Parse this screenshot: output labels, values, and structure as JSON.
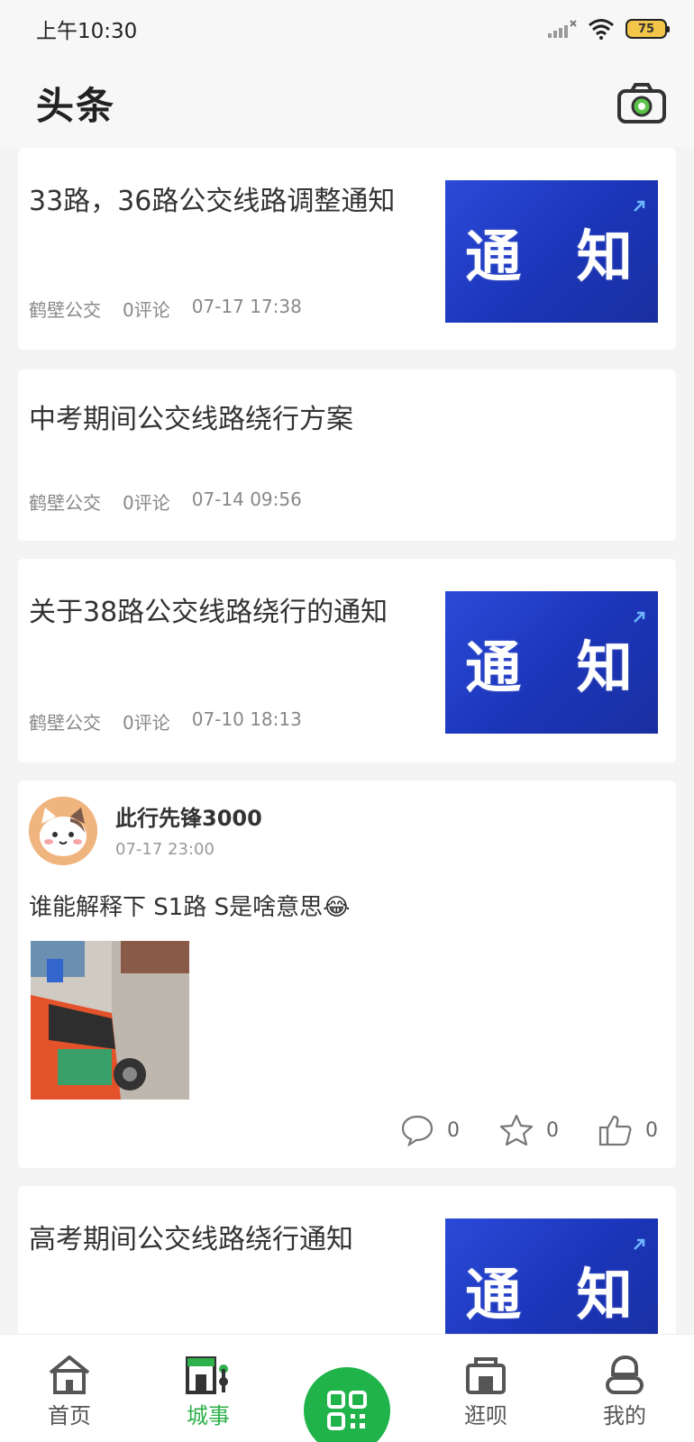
{
  "status_bar": {
    "time": "上午10:30",
    "battery": "75"
  },
  "header": {
    "title": "头条"
  },
  "feed": {
    "news": [
      {
        "title": "33路，36路公交线路调整通知",
        "source": "鹤壁公交",
        "comments": "0评论",
        "date": "07-17 17:38",
        "thumb_text": "通 知"
      },
      {
        "title": "中考期间公交线路绕行方案",
        "source": "鹤壁公交",
        "comments": "0评论",
        "date": "07-14 09:56"
      },
      {
        "title": "关于38路公交线路绕行的通知",
        "source": "鹤壁公交",
        "comments": "0评论",
        "date": "07-10 18:13",
        "thumb_text": "通 知"
      },
      {
        "title": "高考期间公交线路绕行通知",
        "thumb_text": "通 知"
      }
    ],
    "post": {
      "username": "此行先锋3000",
      "time": "07-17 23:00",
      "text": "谁能解释下 S1路  S是啥意思😂",
      "comment_count": "0",
      "favorite_count": "0",
      "like_count": "0"
    }
  },
  "tabbar": {
    "items": [
      {
        "label": "首页",
        "icon": "home-icon"
      },
      {
        "label": "城事",
        "icon": "city-icon",
        "active": true
      },
      {
        "label": "",
        "icon": "qr-scan-icon"
      },
      {
        "label": "逛呗",
        "icon": "shop-icon"
      },
      {
        "label": "我的",
        "icon": "profile-icon"
      }
    ]
  },
  "colors": {
    "accent": "#2fb14b",
    "scan_button": "#1fb34a",
    "thumb_blue": "#1b35b8"
  }
}
